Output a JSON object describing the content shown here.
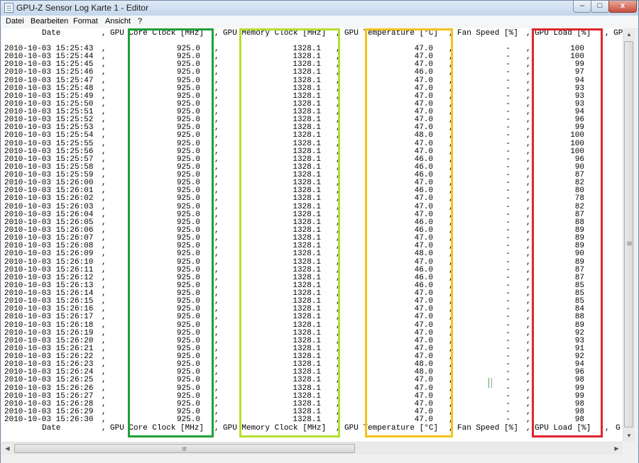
{
  "window": {
    "title": "GPU-Z Sensor Log Karte 1 - Editor",
    "btn_min": "–",
    "btn_max": "□",
    "btn_close": "x"
  },
  "menu": [
    "Datei",
    "Bearbeiten",
    "Format",
    "Ansicht",
    "?"
  ],
  "header": {
    "date": "Date",
    "sep1": ",",
    "core": "GPU Core Clock [MHz]",
    "sep2": ",",
    "mem": "GPU Memory Clock [MHz]",
    "sep3": ",",
    "temp": "GPU Temperature [°C]",
    "sep4": ",",
    "fan": "Fan Speed [%]",
    "sep5": ",",
    "load": "GPU Load [%]",
    "sep6": ",",
    "more": "GP"
  },
  "footer": {
    "date": "Date",
    "sep1": ",",
    "core": "GPU Core Clock [MHz]",
    "sep2": ",",
    "mem": "GPU Memory Clock [MHz]",
    "sep3": ",",
    "temp": "GPU Temperature [°C]",
    "sep4": ",",
    "fan": "Fan Speed [%]",
    "sep5": ",",
    "load": "GPU Load [%]",
    "sep6": ",",
    "more": "G"
  },
  "highlight_colors": {
    "core": "#1fa03a",
    "mem": "#b4e02e",
    "temp": "#f5c218",
    "load": "#e0242c"
  },
  "rows": [
    {
      "date": "2010-10-03 15:25:43",
      "core": "925.0",
      "mem": "1328.1",
      "temp": "47.0",
      "fan": "-",
      "load": "100"
    },
    {
      "date": "2010-10-03 15:25:44",
      "core": "925.0",
      "mem": "1328.1",
      "temp": "47.0",
      "fan": "-",
      "load": "100"
    },
    {
      "date": "2010-10-03 15:25:45",
      "core": "925.0",
      "mem": "1328.1",
      "temp": "47.0",
      "fan": "-",
      "load": "99"
    },
    {
      "date": "2010-10-03 15:25:46",
      "core": "925.0",
      "mem": "1328.1",
      "temp": "46.0",
      "fan": "-",
      "load": "97"
    },
    {
      "date": "2010-10-03 15:25:47",
      "core": "925.0",
      "mem": "1328.1",
      "temp": "47.0",
      "fan": "-",
      "load": "94"
    },
    {
      "date": "2010-10-03 15:25:48",
      "core": "925.0",
      "mem": "1328.1",
      "temp": "47.0",
      "fan": "-",
      "load": "93"
    },
    {
      "date": "2010-10-03 15:25:49",
      "core": "925.0",
      "mem": "1328.1",
      "temp": "47.0",
      "fan": "-",
      "load": "93"
    },
    {
      "date": "2010-10-03 15:25:50",
      "core": "925.0",
      "mem": "1328.1",
      "temp": "47.0",
      "fan": "-",
      "load": "93"
    },
    {
      "date": "2010-10-03 15:25:51",
      "core": "925.0",
      "mem": "1328.1",
      "temp": "47.0",
      "fan": "-",
      "load": "94"
    },
    {
      "date": "2010-10-03 15:25:52",
      "core": "925.0",
      "mem": "1328.1",
      "temp": "47.0",
      "fan": "-",
      "load": "96"
    },
    {
      "date": "2010-10-03 15:25:53",
      "core": "925.0",
      "mem": "1328.1",
      "temp": "47.0",
      "fan": "-",
      "load": "99"
    },
    {
      "date": "2010-10-03 15:25:54",
      "core": "925.0",
      "mem": "1328.1",
      "temp": "48.0",
      "fan": "-",
      "load": "100"
    },
    {
      "date": "2010-10-03 15:25:55",
      "core": "925.0",
      "mem": "1328.1",
      "temp": "47.0",
      "fan": "-",
      "load": "100"
    },
    {
      "date": "2010-10-03 15:25:56",
      "core": "925.0",
      "mem": "1328.1",
      "temp": "47.0",
      "fan": "-",
      "load": "100"
    },
    {
      "date": "2010-10-03 15:25:57",
      "core": "925.0",
      "mem": "1328.1",
      "temp": "46.0",
      "fan": "-",
      "load": "96"
    },
    {
      "date": "2010-10-03 15:25:58",
      "core": "925.0",
      "mem": "1328.1",
      "temp": "46.0",
      "fan": "-",
      "load": "90"
    },
    {
      "date": "2010-10-03 15:25:59",
      "core": "925.0",
      "mem": "1328.1",
      "temp": "46.0",
      "fan": "-",
      "load": "87"
    },
    {
      "date": "2010-10-03 15:26:00",
      "core": "925.0",
      "mem": "1328.1",
      "temp": "47.0",
      "fan": "-",
      "load": "82"
    },
    {
      "date": "2010-10-03 15:26:01",
      "core": "925.0",
      "mem": "1328.1",
      "temp": "46.0",
      "fan": "-",
      "load": "80"
    },
    {
      "date": "2010-10-03 15:26:02",
      "core": "925.0",
      "mem": "1328.1",
      "temp": "47.0",
      "fan": "-",
      "load": "78"
    },
    {
      "date": "2010-10-03 15:26:03",
      "core": "925.0",
      "mem": "1328.1",
      "temp": "47.0",
      "fan": "-",
      "load": "82"
    },
    {
      "date": "2010-10-03 15:26:04",
      "core": "925.0",
      "mem": "1328.1",
      "temp": "47.0",
      "fan": "-",
      "load": "87"
    },
    {
      "date": "2010-10-03 15:26:05",
      "core": "925.0",
      "mem": "1328.1",
      "temp": "46.0",
      "fan": "-",
      "load": "88"
    },
    {
      "date": "2010-10-03 15:26:06",
      "core": "925.0",
      "mem": "1328.1",
      "temp": "46.0",
      "fan": "-",
      "load": "89"
    },
    {
      "date": "2010-10-03 15:26:07",
      "core": "925.0",
      "mem": "1328.1",
      "temp": "47.0",
      "fan": "-",
      "load": "89"
    },
    {
      "date": "2010-10-03 15:26:08",
      "core": "925.0",
      "mem": "1328.1",
      "temp": "47.0",
      "fan": "-",
      "load": "89"
    },
    {
      "date": "2010-10-03 15:26:09",
      "core": "925.0",
      "mem": "1328.1",
      "temp": "48.0",
      "fan": "-",
      "load": "90"
    },
    {
      "date": "2010-10-03 15:26:10",
      "core": "925.0",
      "mem": "1328.1",
      "temp": "47.0",
      "fan": "-",
      "load": "89"
    },
    {
      "date": "2010-10-03 15:26:11",
      "core": "925.0",
      "mem": "1328.1",
      "temp": "46.0",
      "fan": "-",
      "load": "87"
    },
    {
      "date": "2010-10-03 15:26:12",
      "core": "925.0",
      "mem": "1328.1",
      "temp": "46.0",
      "fan": "-",
      "load": "87"
    },
    {
      "date": "2010-10-03 15:26:13",
      "core": "925.0",
      "mem": "1328.1",
      "temp": "46.0",
      "fan": "-",
      "load": "85"
    },
    {
      "date": "2010-10-03 15:26:14",
      "core": "925.0",
      "mem": "1328.1",
      "temp": "47.0",
      "fan": "-",
      "load": "85"
    },
    {
      "date": "2010-10-03 15:26:15",
      "core": "925.0",
      "mem": "1328.1",
      "temp": "47.0",
      "fan": "-",
      "load": "85"
    },
    {
      "date": "2010-10-03 15:26:16",
      "core": "925.0",
      "mem": "1328.1",
      "temp": "47.0",
      "fan": "-",
      "load": "84"
    },
    {
      "date": "2010-10-03 15:26:17",
      "core": "925.0",
      "mem": "1328.1",
      "temp": "47.0",
      "fan": "-",
      "load": "88"
    },
    {
      "date": "2010-10-03 15:26:18",
      "core": "925.0",
      "mem": "1328.1",
      "temp": "47.0",
      "fan": "-",
      "load": "89"
    },
    {
      "date": "2010-10-03 15:26:19",
      "core": "925.0",
      "mem": "1328.1",
      "temp": "47.0",
      "fan": "-",
      "load": "92"
    },
    {
      "date": "2010-10-03 15:26:20",
      "core": "925.0",
      "mem": "1328.1",
      "temp": "47.0",
      "fan": "-",
      "load": "93"
    },
    {
      "date": "2010-10-03 15:26:21",
      "core": "925.0",
      "mem": "1328.1",
      "temp": "47.0",
      "fan": "-",
      "load": "91"
    },
    {
      "date": "2010-10-03 15:26:22",
      "core": "925.0",
      "mem": "1328.1",
      "temp": "47.0",
      "fan": "-",
      "load": "92"
    },
    {
      "date": "2010-10-03 15:26:23",
      "core": "925.0",
      "mem": "1328.1",
      "temp": "48.0",
      "fan": "-",
      "load": "94"
    },
    {
      "date": "2010-10-03 15:26:24",
      "core": "925.0",
      "mem": "1328.1",
      "temp": "48.0",
      "fan": "-",
      "load": "96"
    },
    {
      "date": "2010-10-03 15:26:25",
      "core": "925.0",
      "mem": "1328.1",
      "temp": "47.0",
      "fan": "-",
      "load": "98"
    },
    {
      "date": "2010-10-03 15:26:26",
      "core": "925.0",
      "mem": "1328.1",
      "temp": "47.0",
      "fan": "-",
      "load": "99"
    },
    {
      "date": "2010-10-03 15:26:27",
      "core": "925.0",
      "mem": "1328.1",
      "temp": "47.0",
      "fan": "-",
      "load": "99"
    },
    {
      "date": "2010-10-03 15:26:28",
      "core": "925.0",
      "mem": "1328.1",
      "temp": "47.0",
      "fan": "-",
      "load": "98"
    },
    {
      "date": "2010-10-03 15:26:29",
      "core": "925.0",
      "mem": "1328.1",
      "temp": "47.0",
      "fan": "-",
      "load": "98"
    },
    {
      "date": "2010-10-03 15:26:30",
      "core": "925.0",
      "mem": "1328.1",
      "temp": "47.0",
      "fan": "-",
      "load": "98"
    }
  ]
}
